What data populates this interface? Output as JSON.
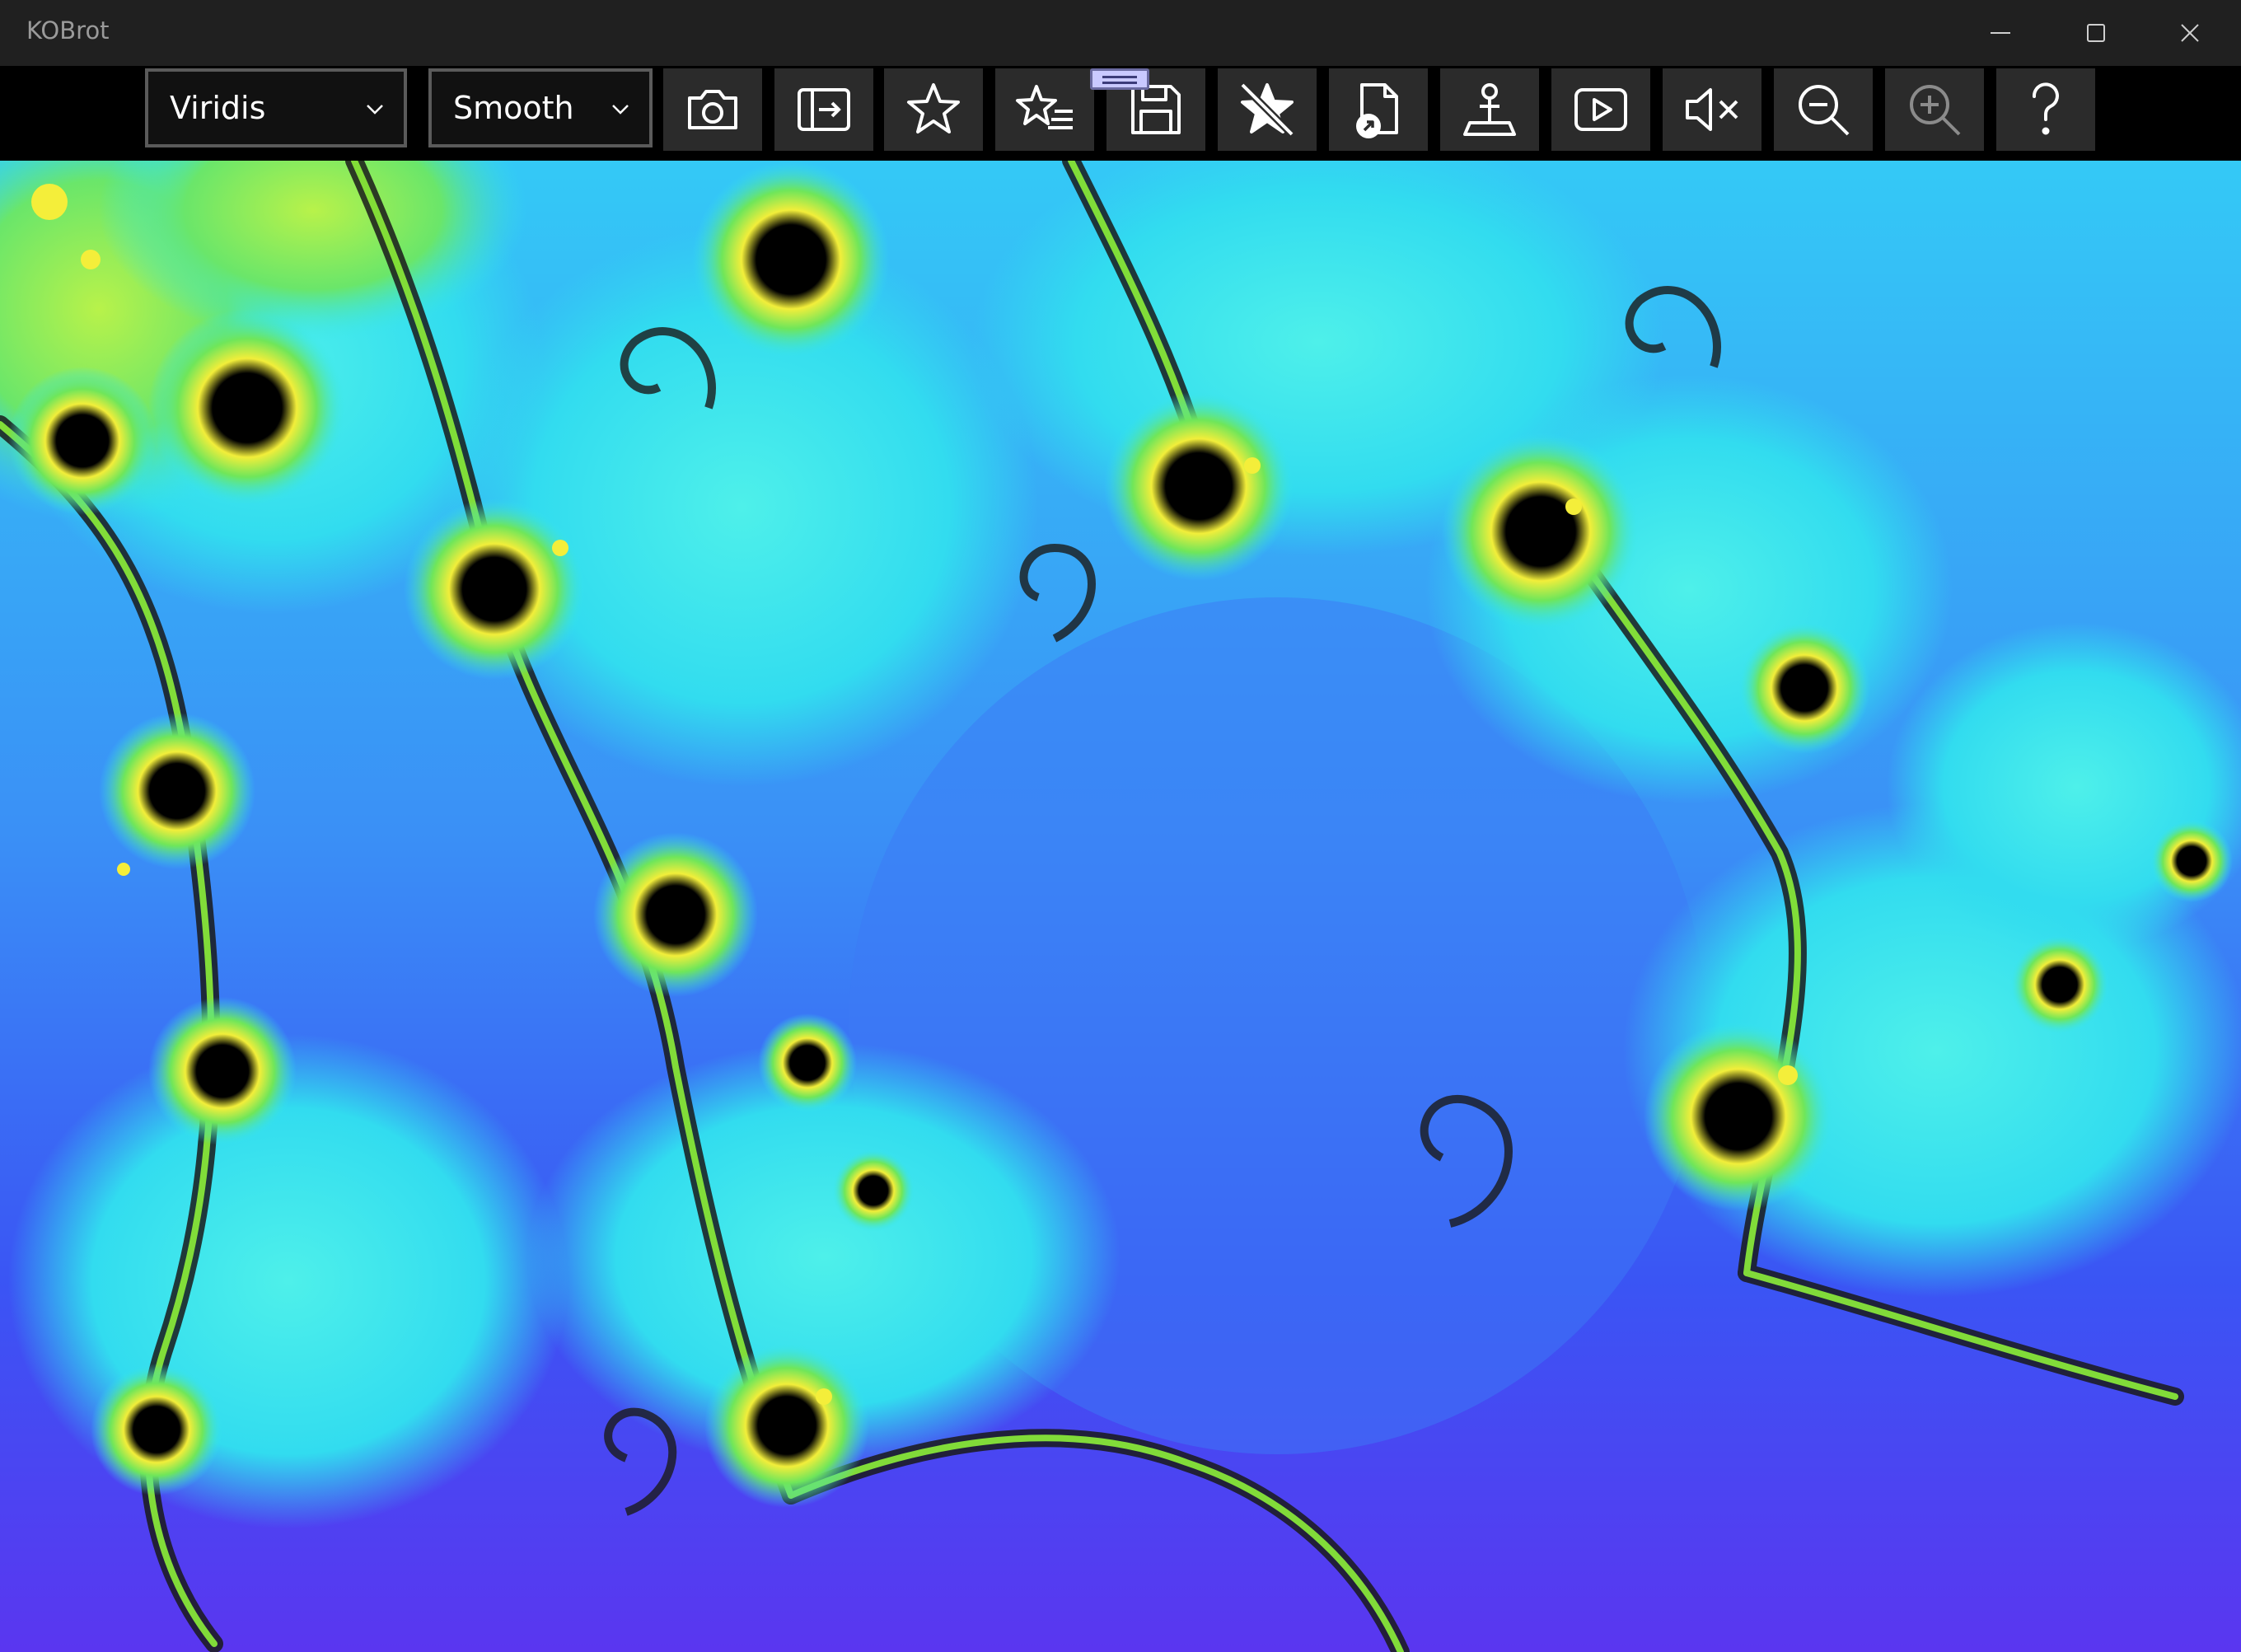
{
  "window": {
    "title": "KOBrot"
  },
  "toolbar": {
    "palette_value": "Viridis",
    "shading_value": "Smooth",
    "buttons": [
      {
        "icon": "camera-icon",
        "action": "screenshot"
      },
      {
        "icon": "export-icon",
        "action": "export"
      },
      {
        "icon": "star-icon",
        "action": "add-favorite"
      },
      {
        "icon": "favorites-list-icon",
        "action": "favorites"
      },
      {
        "icon": "save-icon",
        "action": "save"
      },
      {
        "icon": "star-off-icon",
        "action": "remove-favorite"
      },
      {
        "icon": "open-file-icon",
        "action": "open"
      },
      {
        "icon": "orbit-icon",
        "action": "orbit"
      },
      {
        "icon": "play-icon",
        "action": "play"
      },
      {
        "icon": "mute-icon",
        "action": "mute"
      },
      {
        "icon": "zoom-out-icon",
        "action": "zoom-out"
      },
      {
        "icon": "zoom-in-icon",
        "action": "zoom-in",
        "disabled": true
      },
      {
        "icon": "help-icon",
        "action": "help"
      }
    ]
  },
  "colors": {
    "titlebar": "#202020",
    "toolbar": "#000000",
    "button": "#2b2b2b",
    "fractal_interior": "#000000",
    "fractal_yellow": "#f2ee3a",
    "fractal_green": "#7fe85a",
    "fractal_cyan": "#34e6ef",
    "background_top": "#33c8f6",
    "background_mid": "#3a6ff5",
    "background_bottom": "#5a38f2"
  }
}
